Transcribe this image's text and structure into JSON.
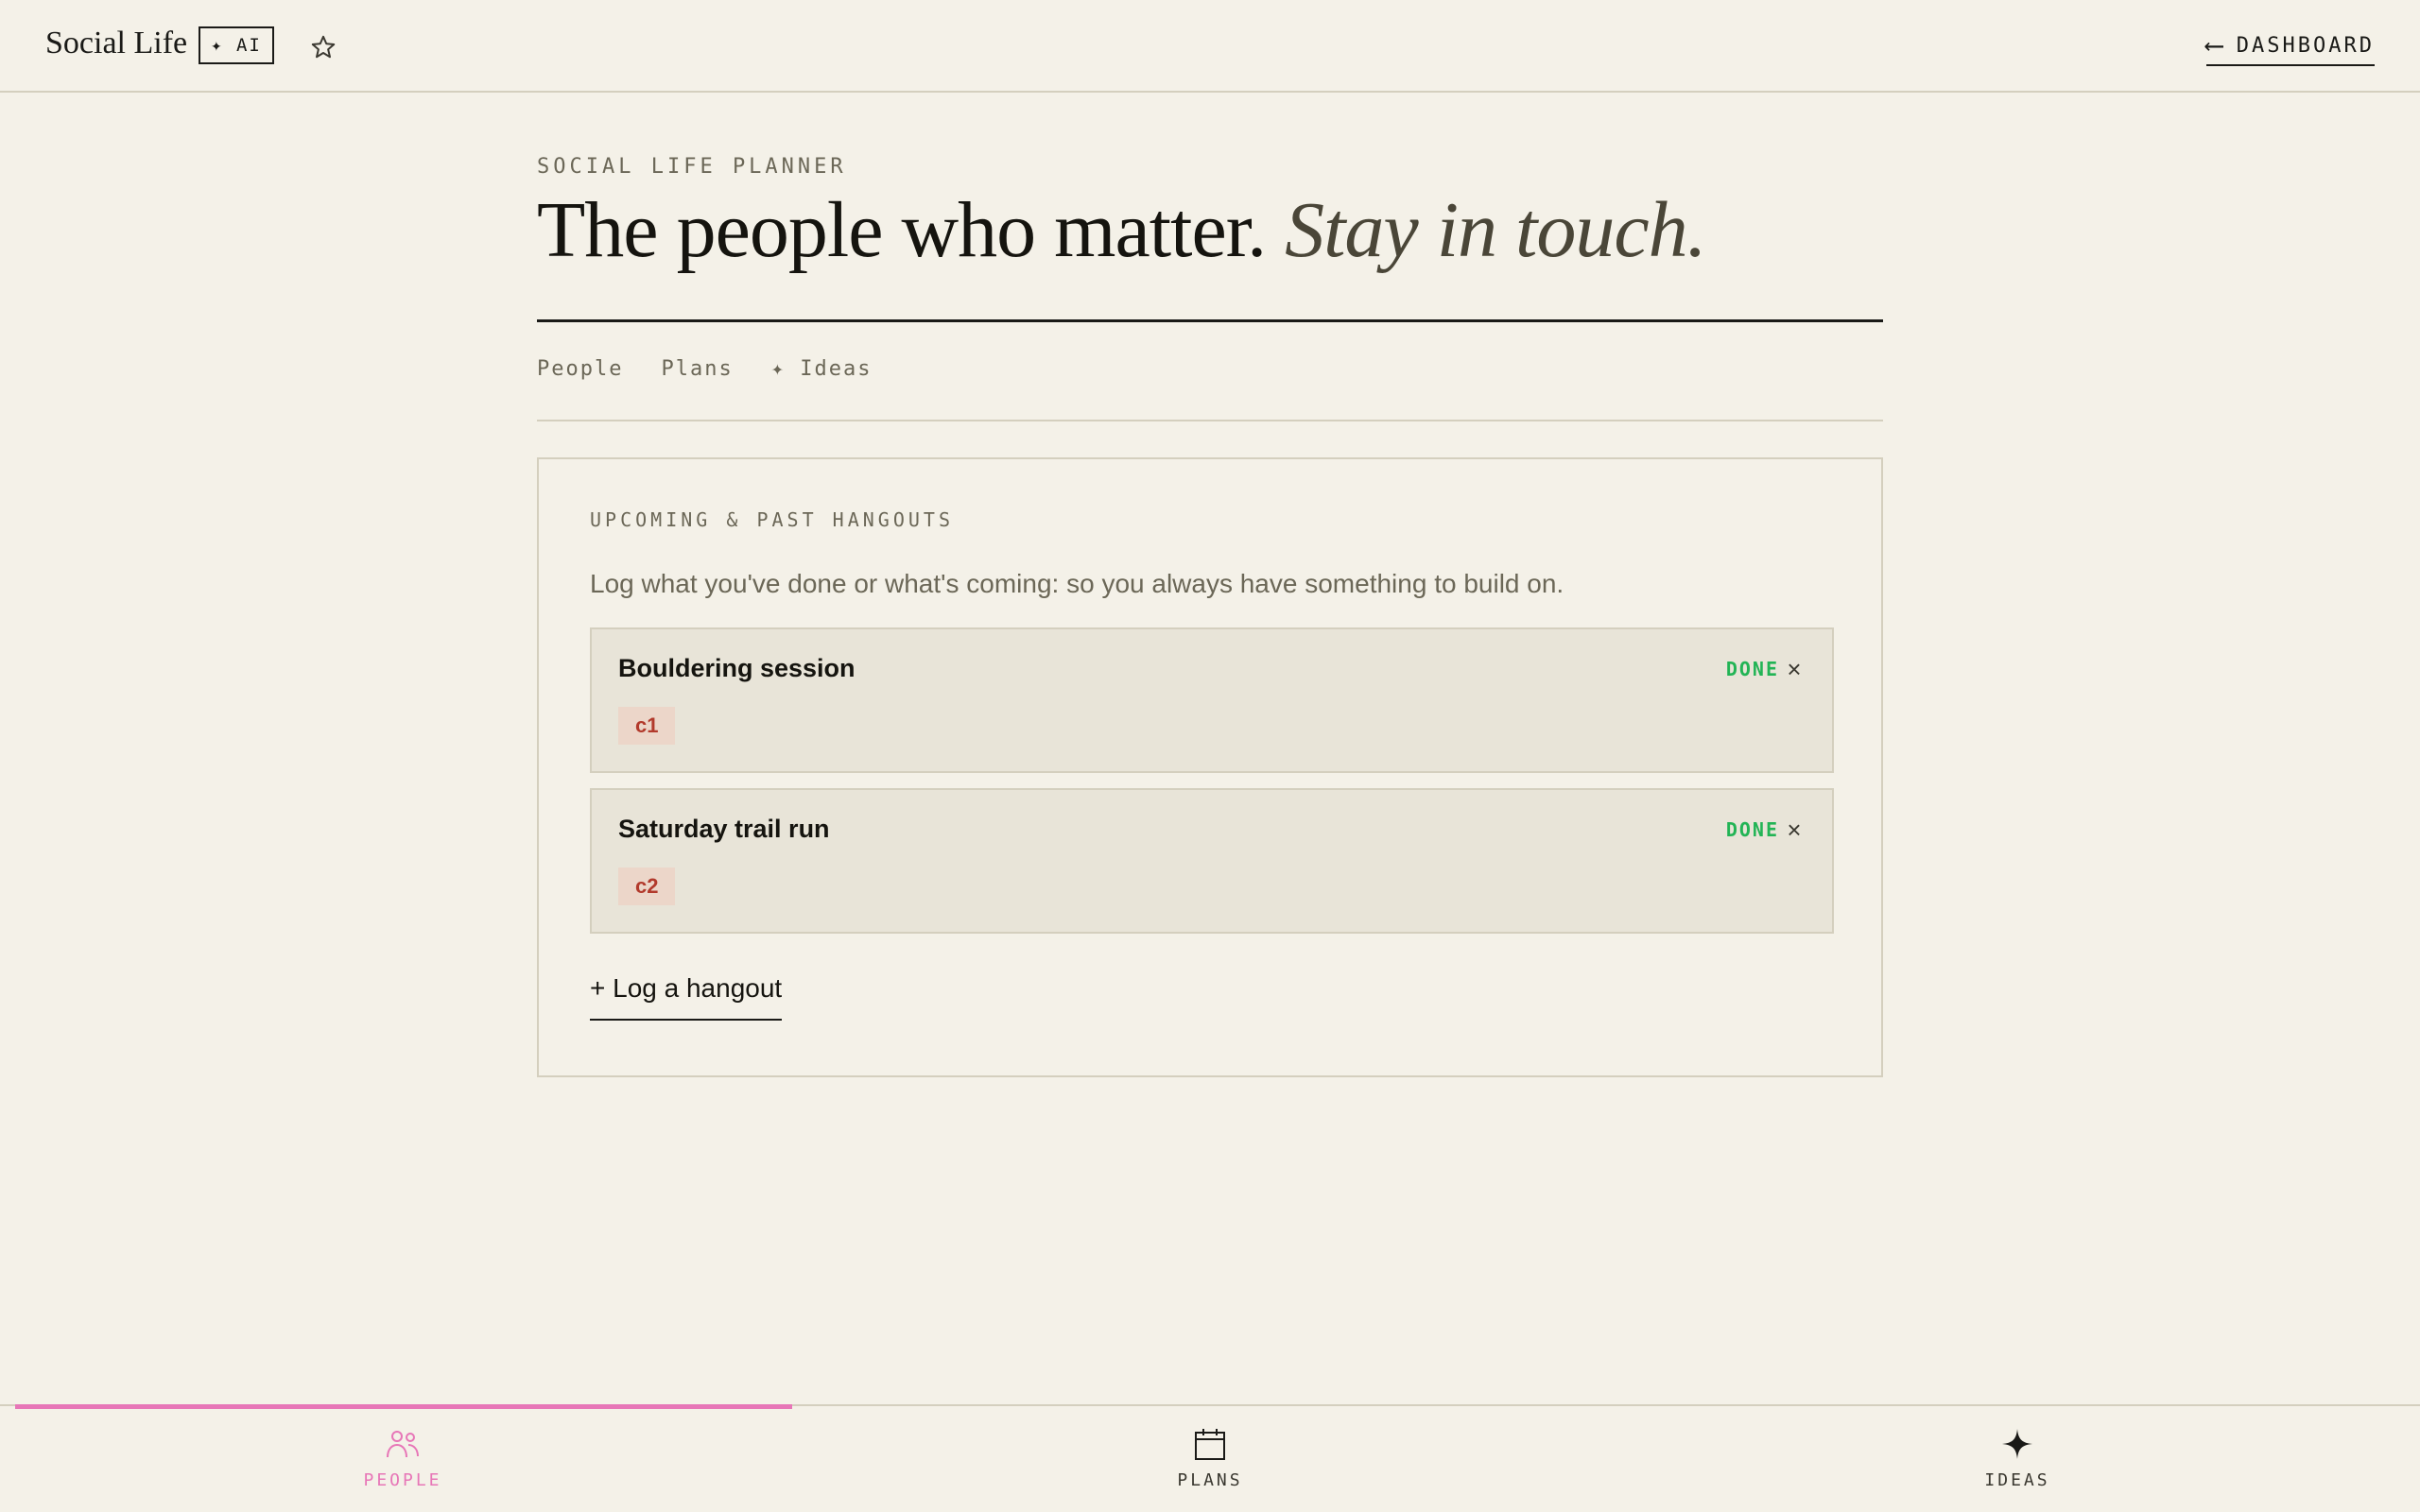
{
  "topbar": {
    "brand": "Social Life",
    "ai_badge": "✦ AI",
    "star_icon": "star-icon",
    "dashboard_arrow": "⟵",
    "dashboard_label": "DASHBOARD"
  },
  "header": {
    "eyebrow": "SOCIAL LIFE PLANNER",
    "title_main": "The people who matter.",
    "title_italic": "Stay in touch."
  },
  "tabs": [
    "People",
    "Plans",
    "✦ Ideas"
  ],
  "card": {
    "eyebrow": "UPCOMING & PAST HANGOUTS",
    "description": "Log what you've done or what's coming: so you always have something to build on.",
    "hangouts": [
      {
        "title": "Bouldering session",
        "tag": "c1",
        "status": "DONE",
        "close": "×"
      },
      {
        "title": "Saturday trail run",
        "tag": "c2",
        "status": "DONE",
        "close": "×"
      }
    ],
    "log_link": "+ Log a hangout"
  },
  "bottom_nav": {
    "items": [
      {
        "label": "PEOPLE",
        "icon": "people-icon",
        "active": true
      },
      {
        "label": "PLANS",
        "icon": "calendar-icon",
        "active": false
      },
      {
        "label": "IDEAS",
        "icon": "sparkle-icon",
        "active": false
      }
    ]
  },
  "colors": {
    "background": "#f4f1e8",
    "accent_pink": "#e776b7",
    "done_green": "#22b455",
    "tag_red": "#b23a2c"
  }
}
